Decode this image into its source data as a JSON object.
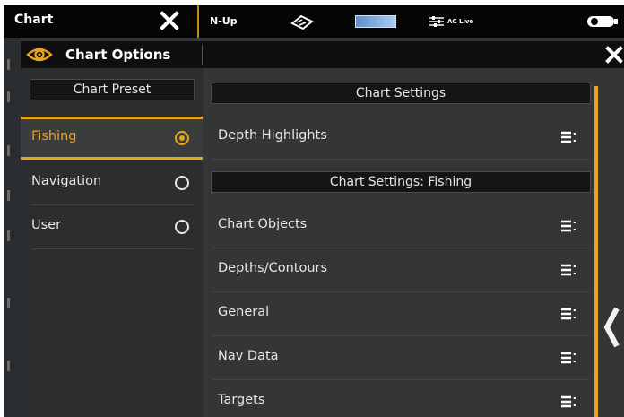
{
  "topbar": {
    "title": "Chart",
    "close_icon": "close-x-icon",
    "view_label": "N-Up",
    "ac_label": "AC Live",
    "signal_icon": "sonar-signal-icon",
    "battery_icon": "battery-icon"
  },
  "dialog": {
    "title": "Chart Options",
    "title_icon": "eye-icon",
    "close_icon": "close-x-icon",
    "accent_color": "#e8a21c",
    "preset_header": "Chart Preset",
    "presets": [
      {
        "label": "Fishing",
        "selected": true
      },
      {
        "label": "Navigation",
        "selected": false
      },
      {
        "label": "User",
        "selected": false
      }
    ],
    "settings_header": "Chart Settings",
    "settings_items": [
      {
        "label": "Depth Highlights",
        "icon": "menu-list-icon"
      }
    ],
    "fishing_header": "Chart Settings: Fishing",
    "fishing_items": [
      {
        "label": "Chart Objects",
        "icon": "menu-list-icon"
      },
      {
        "label": "Depths/Contours",
        "icon": "menu-list-icon"
      },
      {
        "label": "General",
        "icon": "menu-list-icon"
      },
      {
        "label": "Nav Data",
        "icon": "menu-list-icon"
      },
      {
        "label": "Targets",
        "icon": "menu-list-icon"
      }
    ],
    "side_button_icon": "chevron-left-icon"
  }
}
